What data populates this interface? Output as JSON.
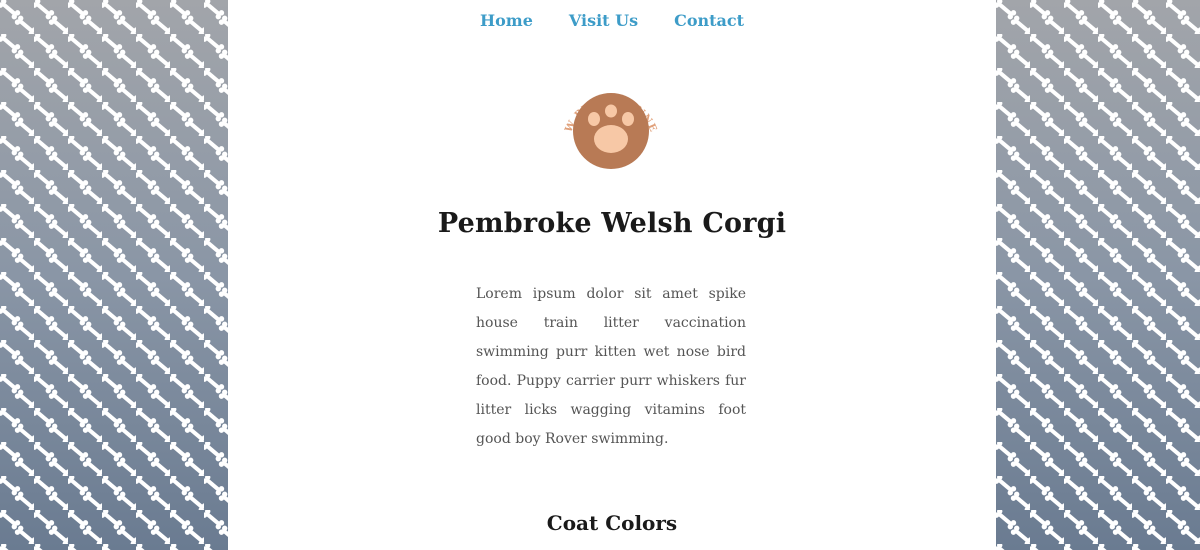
{
  "nav": {
    "items": [
      {
        "label": "Home"
      },
      {
        "label": "Visit Us"
      },
      {
        "label": "Contact"
      }
    ]
  },
  "logo": {
    "text": "PAW PRINT KENNELS",
    "colors": {
      "circle": "#b87a55",
      "pads": "#f7c8a6",
      "arc_text": "#e0a07a"
    }
  },
  "main": {
    "title": "Pembroke Welsh Corgi",
    "description": "Lorem ipsum dolor sit amet spike house train litter vaccination swimming purr kitten wet nose bird food. Puppy carrier purr whiskers fur litter licks wagging vitamins foot good boy Rover swimming.",
    "section_heading": "Coat Colors"
  },
  "theme": {
    "link_color": "#3d9cc8",
    "background_top": "#a2a5aa",
    "background_bottom": "#6a7b91"
  }
}
